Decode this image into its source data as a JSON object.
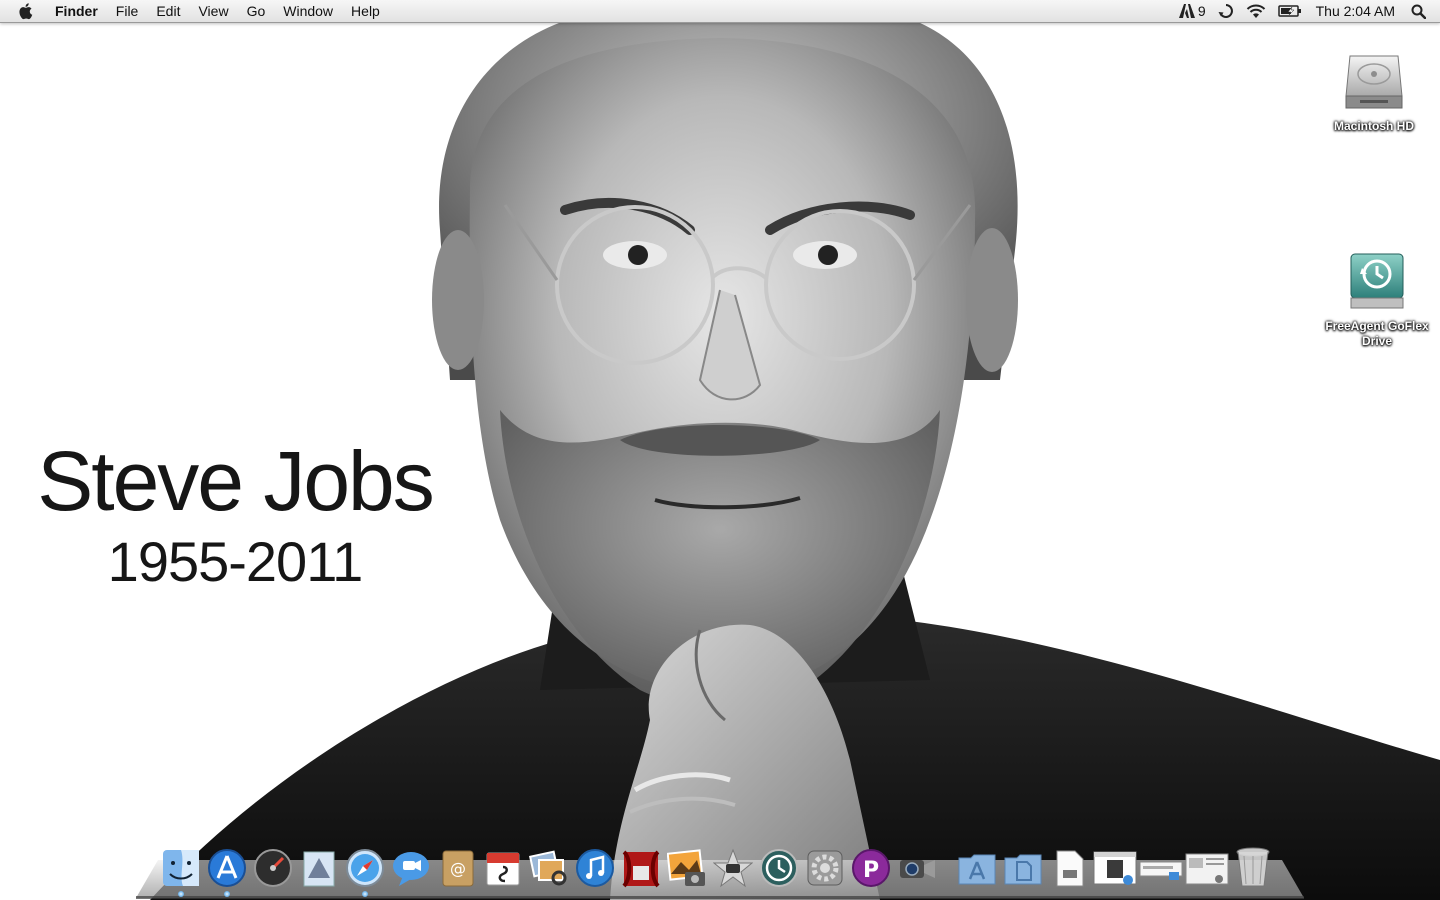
{
  "menubar": {
    "app_name": "Finder",
    "menus": [
      "File",
      "Edit",
      "View",
      "Go",
      "Window",
      "Help"
    ],
    "adobe_count": "9",
    "clock": "Thu 2:04 AM",
    "status_icons": [
      "adobe-icon",
      "sync-icon",
      "wifi-icon",
      "battery-icon",
      "spotlight-icon"
    ]
  },
  "wallpaper": {
    "name": "Steve Jobs",
    "years": "1955-2011"
  },
  "desktop": {
    "icons": [
      {
        "label": "Macintosh HD",
        "icon": "hard-drive-icon"
      },
      {
        "label": "FreeAgent GoFlex Drive",
        "icon": "time-machine-drive-icon"
      }
    ]
  },
  "dock": {
    "apps": [
      {
        "icon": "finder-icon",
        "running": true
      },
      {
        "icon": "app-store-icon",
        "running": true
      },
      {
        "icon": "dashboard-icon",
        "running": false
      },
      {
        "icon": "mail-icon",
        "running": false
      },
      {
        "icon": "safari-icon",
        "running": true
      },
      {
        "icon": "ichat-icon",
        "running": false
      },
      {
        "icon": "address-book-icon",
        "running": false
      },
      {
        "icon": "ical-icon",
        "running": false
      },
      {
        "icon": "preview-icon",
        "running": false
      },
      {
        "icon": "itunes-icon",
        "running": false
      },
      {
        "icon": "front-row-icon",
        "running": false
      },
      {
        "icon": "iphoto-icon",
        "running": false
      },
      {
        "icon": "imovie-icon",
        "running": false
      },
      {
        "icon": "time-machine-icon",
        "running": false
      },
      {
        "icon": "system-preferences-icon",
        "running": false
      },
      {
        "icon": "p3-app-icon",
        "running": false
      },
      {
        "icon": "facetime-camera-icon",
        "running": false
      }
    ],
    "stacks": [
      {
        "icon": "applications-folder-icon"
      },
      {
        "icon": "documents-folder-icon"
      },
      {
        "icon": "document-file-icon"
      },
      {
        "icon": "minimized-window-icon"
      },
      {
        "icon": "minimized-window-icon"
      },
      {
        "icon": "minimized-window-icon"
      },
      {
        "icon": "trash-icon"
      }
    ]
  },
  "colors": {
    "menubar_bg": "#e9e9e9",
    "memorial_text": "#161616",
    "label_text": "#ffffff"
  }
}
